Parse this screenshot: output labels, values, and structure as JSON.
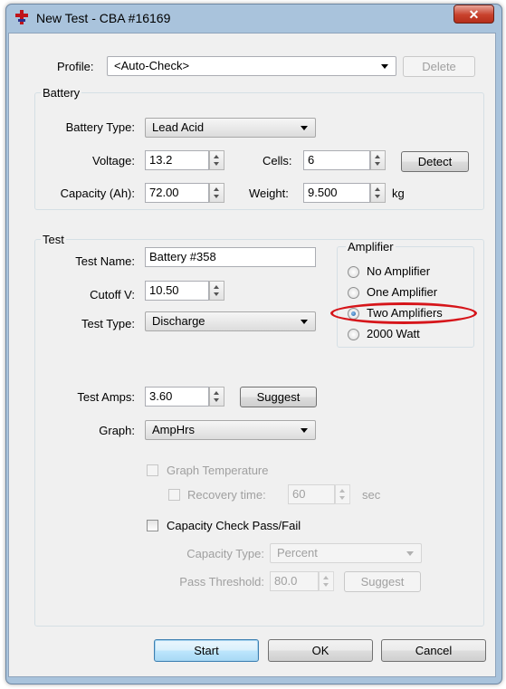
{
  "window": {
    "title": "New Test - CBA #16169",
    "close_glyph": "✕"
  },
  "profile": {
    "label": "Profile:",
    "value": "<Auto-Check>",
    "delete_label": "Delete"
  },
  "battery": {
    "group_label": "Battery",
    "type_label": "Battery Type:",
    "type_value": "Lead Acid",
    "voltage_label": "Voltage:",
    "voltage_value": "13.2",
    "cells_label": "Cells:",
    "cells_value": "6",
    "detect_label": "Detect",
    "capacity_label": "Capacity (Ah):",
    "capacity_value": "72.00",
    "weight_label": "Weight:",
    "weight_value": "9.500",
    "weight_unit": "kg"
  },
  "test": {
    "group_label": "Test",
    "name_label": "Test Name:",
    "name_value": "Battery #358",
    "cutoff_label": "Cutoff V:",
    "cutoff_value": "10.50",
    "type_label": "Test Type:",
    "type_value": "Discharge",
    "amps_label": "Test Amps:",
    "amps_value": "3.60",
    "suggest_label": "Suggest",
    "graph_label": "Graph:",
    "graph_value": "AmpHrs",
    "graph_temp_label": "Graph Temperature",
    "recovery_label": "Recovery time:",
    "recovery_value": "60",
    "recovery_unit": "sec",
    "capacity_check_label": "Capacity Check Pass/Fail",
    "capacity_type_label": "Capacity Type:",
    "capacity_type_value": "Percent",
    "pass_threshold_label": "Pass Threshold:",
    "pass_threshold_value": "80.0",
    "threshold_suggest_label": "Suggest"
  },
  "amplifier": {
    "group_label": "Amplifier",
    "options": [
      {
        "label": "No Amplifier",
        "selected": false
      },
      {
        "label": "One Amplifier",
        "selected": false
      },
      {
        "label": "Two Amplifiers",
        "selected": true
      },
      {
        "label": "2000 Watt",
        "selected": false
      }
    ],
    "highlight_color": "#d6151a"
  },
  "footer": {
    "start_label": "Start",
    "ok_label": "OK",
    "cancel_label": "Cancel"
  }
}
